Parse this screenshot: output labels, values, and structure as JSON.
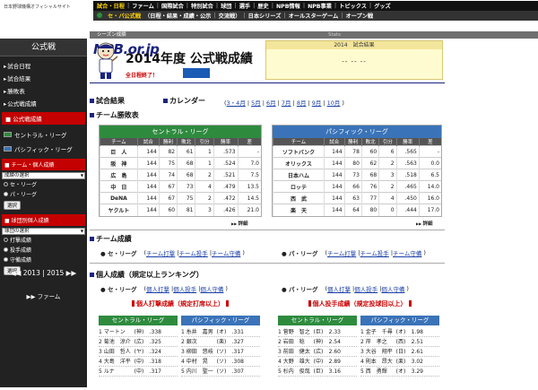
{
  "logo": {
    "main": "NPB.or.jp",
    "sub": "日本野球機構オフィシャルサイト"
  },
  "nav1": [
    "試合・日程",
    "ファーム",
    "国際試合",
    "特別試合",
    "球団",
    "選手",
    "歴史",
    "NPB情報",
    "NPB事業",
    "トピックス",
    "グッズ"
  ],
  "nav2": [
    "セ・パ公式戦",
    "（日程・結果・成績・公示",
    "交流戦）",
    "日本シリーズ",
    "オールスターゲーム",
    "オープン戦"
  ],
  "subbar": {
    "left": "シーズン成績",
    "right": "Stats"
  },
  "sidebar": {
    "title": "公式戦",
    "items": [
      "試合日程",
      "試合結果",
      "勝敗表",
      "公式戦成績"
    ],
    "active": "公式戦成績",
    "leagues": [
      "セントラル・リーグ",
      "パシフィック・リーグ"
    ],
    "team_box": "チーム・個人成績",
    "team_select": "成績の選択",
    "radio1": [
      "セ・リーグ",
      "パ・リーグ"
    ],
    "btn": "選択",
    "club_box": "球団別個人成績",
    "club_select": "球団の選択",
    "radio2": [
      "打撃成績",
      "投手成績",
      "守備成績"
    ],
    "btn2": "選択",
    "year_prev": "2013",
    "year_sep": "|",
    "year_cur": "2015",
    "farm": "ファーム"
  },
  "page": {
    "title": "2014年度 公式戦成績",
    "clinch": "全日程終了！"
  },
  "results_box": {
    "title": "2014　試合結果",
    "value": "-- -- --"
  },
  "sections": {
    "results": "試合結果",
    "calendar": "カレンダー",
    "standings": "チーム勝敗表",
    "team_stats": "チーム成績",
    "individual": "個人成績（規定以上ランキング）"
  },
  "months": [
    "3・4月",
    "5月",
    "6月",
    "7月",
    "8月",
    "9月",
    "10月"
  ],
  "standings_header": [
    "チーム",
    "試合",
    "勝利",
    "敗北",
    "引分",
    "勝率",
    "差"
  ],
  "central": {
    "title": "セントラル・リーグ",
    "color": "#2e8b3e",
    "rows": [
      [
        "巨　人",
        "144",
        "82",
        "61",
        "1",
        ".573",
        "-"
      ],
      [
        "阪　神",
        "144",
        "75",
        "68",
        "1",
        ".524",
        "7.0"
      ],
      [
        "広　島",
        "144",
        "74",
        "68",
        "2",
        ".521",
        "7.5"
      ],
      [
        "中　日",
        "144",
        "67",
        "73",
        "4",
        ".479",
        "13.5"
      ],
      [
        "DeNA",
        "144",
        "67",
        "75",
        "2",
        ".472",
        "14.5"
      ],
      [
        "ヤクルト",
        "144",
        "60",
        "81",
        "3",
        ".426",
        "21.0"
      ]
    ]
  },
  "pacific": {
    "title": "パシフィック・リーグ",
    "color": "#3a73b8",
    "rows": [
      [
        "ソフトバンク",
        "144",
        "78",
        "60",
        "6",
        ".565",
        "-"
      ],
      [
        "オリックス",
        "144",
        "80",
        "62",
        "2",
        ".563",
        "0.0"
      ],
      [
        "日本ハム",
        "144",
        "73",
        "68",
        "3",
        ".518",
        "6.5"
      ],
      [
        "ロッテ",
        "144",
        "66",
        "76",
        "2",
        ".465",
        "14.0"
      ],
      [
        "西　武",
        "144",
        "63",
        "77",
        "4",
        ".450",
        "16.0"
      ],
      [
        "楽　天",
        "144",
        "64",
        "80",
        "0",
        ".444",
        "17.0"
      ]
    ]
  },
  "detail_label": "詳細",
  "team_links": {
    "ce_label": "セ・リーグ",
    "pa_label": "パ・リーグ",
    "ce": [
      "チーム打撃",
      "チーム投手",
      "チーム守備"
    ],
    "pa": [
      "チーム打撃",
      "チーム投手",
      "チーム守備"
    ]
  },
  "indiv_links": {
    "ce_label": "セ・リーグ",
    "pa_label": "パ・リーグ",
    "ce": [
      "個人打撃",
      "個人投手",
      "個人守備"
    ],
    "pa": [
      "個人打撃",
      "個人投手",
      "個人守備"
    ]
  },
  "batting_title": "個人打撃成績（規定打席以上）",
  "pitching_title": "個人投手成績（規定投球回以上）",
  "rank_heads": [
    "セントラル・リーグ",
    "パシフィック・リーグ",
    "セントラル・リーグ",
    "パシフィック・リーグ"
  ],
  "batting_ce": [
    [
      "1 マートン",
      "(神)",
      ".338"
    ],
    [
      "2 菊池　涼介",
      "(広)",
      ".325"
    ],
    [
      "3 山田　哲人",
      "(ヤ)",
      ".324"
    ],
    [
      "4 大島　洋平",
      "(中)",
      ".318"
    ],
    [
      "5 ルナ",
      "(中)",
      ".317"
    ]
  ],
  "batting_pa": [
    [
      "1 糸井　嘉男",
      "(オ)",
      ".331"
    ],
    [
      "2 銀次",
      "(楽)",
      ".327"
    ],
    [
      "3 柳田　悠岐",
      "(ソ)",
      ".317"
    ],
    [
      "4 中村　晃",
      "(ソ)",
      ".308"
    ],
    [
      "5 内川　聖一",
      "(ソ)",
      ".307"
    ]
  ],
  "pitching_ce": [
    [
      "1 菅野　智之",
      "(巨)",
      "2.33"
    ],
    [
      "2 岩田　稔",
      "(神)",
      "2.54"
    ],
    [
      "3 前田　健太",
      "(広)",
      "2.60"
    ],
    [
      "4 大野　雄大",
      "(中)",
      "2.89"
    ],
    [
      "5 杉内　俊哉",
      "(巨)",
      "3.16"
    ]
  ],
  "pitching_pa": [
    [
      "1 金子　千尋",
      "(オ)",
      "1.98"
    ],
    [
      "2 岸　孝之",
      "(西)",
      "2.51"
    ],
    [
      "3 大谷　翔平",
      "(日)",
      "2.61"
    ],
    [
      "4 則本　昂大",
      "(楽)",
      "3.02"
    ],
    [
      "5 西　勇輝",
      "(オ)",
      "3.29"
    ]
  ]
}
